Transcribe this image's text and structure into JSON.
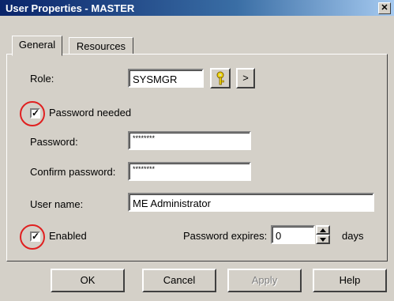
{
  "window": {
    "title": "User Properties - MASTER",
    "close_glyph": "✕"
  },
  "tabs": [
    {
      "label": "General"
    },
    {
      "label": "Resources"
    }
  ],
  "form": {
    "role_label": "Role:",
    "role_value": "SYSMGR",
    "role_key_icon": "key-icon",
    "role_next_glyph": ">",
    "password_needed_label": "Password needed",
    "password_needed_checked": true,
    "password_label": "Password:",
    "password_value": "********",
    "confirm_password_label": "Confirm password:",
    "confirm_password_value": "********",
    "user_name_label": "User name:",
    "user_name_value": "ME Administrator",
    "enabled_label": "Enabled",
    "enabled_checked": true,
    "password_expires_label": "Password expires:",
    "password_expires_value": "0",
    "days_label": "days",
    "check_glyph": "✓"
  },
  "buttons": {
    "ok": "OK",
    "cancel": "Cancel",
    "apply": "Apply",
    "help": "Help"
  },
  "colors": {
    "highlight_ring": "#e02020",
    "title_bar": "#0a246a"
  }
}
